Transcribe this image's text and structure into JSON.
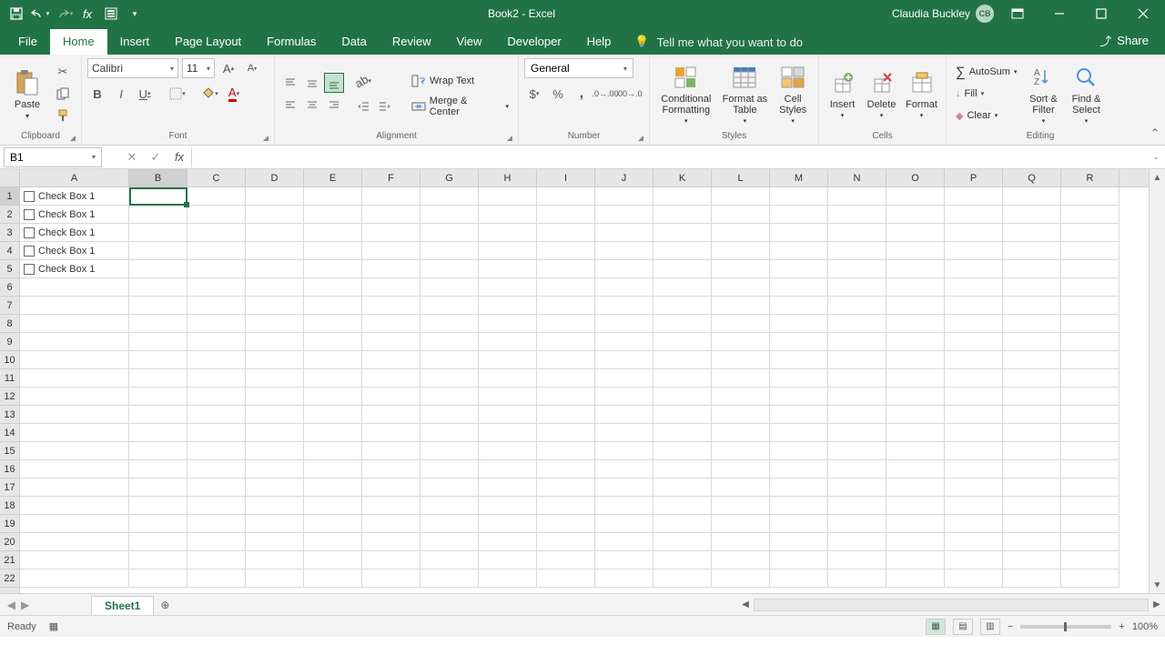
{
  "titlebar": {
    "title": "Book2 - Excel",
    "user": "Claudia Buckley",
    "avatar": "CB"
  },
  "tabs": {
    "file": "File",
    "home": "Home",
    "insert": "Insert",
    "page_layout": "Page Layout",
    "formulas": "Formulas",
    "data": "Data",
    "review": "Review",
    "view": "View",
    "developer": "Developer",
    "help": "Help",
    "tellme": "Tell me what you want to do",
    "share": "Share"
  },
  "ribbon": {
    "clipboard": {
      "label": "Clipboard",
      "paste": "Paste"
    },
    "font": {
      "label": "Font",
      "name": "Calibri",
      "size": "11"
    },
    "alignment": {
      "label": "Alignment",
      "wrap": "Wrap Text",
      "merge": "Merge & Center"
    },
    "number": {
      "label": "Number",
      "format": "General"
    },
    "styles": {
      "label": "Styles",
      "cond": "Conditional Formatting",
      "table": "Format as Table",
      "cell": "Cell Styles"
    },
    "cells": {
      "label": "Cells",
      "insert": "Insert",
      "delete": "Delete",
      "format": "Format"
    },
    "editing": {
      "label": "Editing",
      "autosum": "AutoSum",
      "fill": "Fill",
      "clear": "Clear",
      "sort": "Sort & Filter",
      "find": "Find & Select"
    }
  },
  "namebox": "B1",
  "columns": [
    "A",
    "B",
    "C",
    "D",
    "E",
    "F",
    "G",
    "H",
    "I",
    "J",
    "K",
    "L",
    "M",
    "N",
    "O",
    "P",
    "Q",
    "R"
  ],
  "rows": [
    1,
    2,
    3,
    4,
    5,
    6,
    7,
    8,
    9,
    10,
    11,
    12,
    13,
    14,
    15,
    16,
    17,
    18,
    19,
    20,
    21,
    22
  ],
  "checkboxes": [
    {
      "row": 1,
      "label": "Check Box 1"
    },
    {
      "row": 2,
      "label": "Check Box 1"
    },
    {
      "row": 3,
      "label": "Check Box 1"
    },
    {
      "row": 4,
      "label": "Check Box 1"
    },
    {
      "row": 5,
      "label": "Check Box 1"
    }
  ],
  "selected_cell": "B1",
  "sheets": {
    "active": "Sheet1"
  },
  "status": {
    "ready": "Ready",
    "zoom": "100%"
  }
}
